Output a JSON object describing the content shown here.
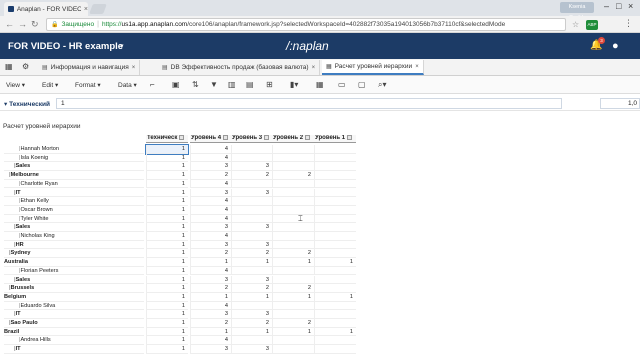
{
  "browser": {
    "tab_title": "Anaplan - FOR VIDEO - H",
    "user_chip": "Ksenia Gorikh",
    "secure_label": "Защищено",
    "url_scheme": "https://",
    "url_host": "us1a.app.anaplan.com",
    "url_path": "/core106/anaplan/framework.jsp?selectedWorkspaceId=402882f73035a194013056b7b37110cf&selectedMode",
    "ext_label": "ABP",
    "icons": [
      "back-icon",
      "forward-icon",
      "reload-icon",
      "lock-icon",
      "star-icon",
      "menu-icon"
    ]
  },
  "app": {
    "model_name": "FOR VIDEO - HR example",
    "logo": "/:naplan",
    "notifications": "3",
    "accent_color": "#1c3b66"
  },
  "module_tabs": [
    {
      "label": "Информация и навигация",
      "active": false
    },
    {
      "label": "DB Эффективность продаж (базовая валюта)",
      "active": false
    },
    {
      "label": "Расчет уровней иерархии",
      "active": true
    }
  ],
  "toolbar": {
    "view": "View",
    "edit": "Edit",
    "format": "Format",
    "data": "Data"
  },
  "context": {
    "dimension": "Технический",
    "value": "1",
    "right_value": "1,0"
  },
  "grid": {
    "title": "Расчет уровней иерархии",
    "columns": [
      "Техническ",
      "Уровень 4",
      "Уровень 3",
      "Уровень 2",
      "Уровень 1"
    ],
    "rows": [
      {
        "label": "Hannah Morton",
        "indent": 3,
        "bold": false,
        "v": [
          "1",
          "4",
          "",
          "",
          ""
        ]
      },
      {
        "label": "Isla Koenig",
        "indent": 3,
        "bold": false,
        "v": [
          "1",
          "4",
          "",
          "",
          ""
        ]
      },
      {
        "label": "Sales",
        "indent": 2,
        "bold": true,
        "v": [
          "1",
          "3",
          "3",
          "",
          ""
        ]
      },
      {
        "label": "Melbourne",
        "indent": 1,
        "bold": true,
        "v": [
          "1",
          "2",
          "2",
          "2",
          ""
        ]
      },
      {
        "label": "Charlotte Ryan",
        "indent": 3,
        "bold": false,
        "v": [
          "1",
          "4",
          "",
          "",
          ""
        ]
      },
      {
        "label": "IT",
        "indent": 2,
        "bold": true,
        "v": [
          "1",
          "3",
          "3",
          "",
          ""
        ]
      },
      {
        "label": "Ethan Kelly",
        "indent": 3,
        "bold": false,
        "v": [
          "1",
          "4",
          "",
          "",
          ""
        ]
      },
      {
        "label": "Oscar Brown",
        "indent": 3,
        "bold": false,
        "v": [
          "1",
          "4",
          "",
          "",
          ""
        ]
      },
      {
        "label": "Tyler White",
        "indent": 3,
        "bold": false,
        "v": [
          "1",
          "4",
          "",
          "",
          ""
        ]
      },
      {
        "label": "Sales",
        "indent": 2,
        "bold": true,
        "v": [
          "1",
          "3",
          "3",
          "",
          ""
        ]
      },
      {
        "label": "Nicholas King",
        "indent": 3,
        "bold": false,
        "v": [
          "1",
          "4",
          "",
          "",
          ""
        ]
      },
      {
        "label": "HR",
        "indent": 2,
        "bold": true,
        "v": [
          "1",
          "3",
          "3",
          "",
          ""
        ]
      },
      {
        "label": "Sydney",
        "indent": 1,
        "bold": true,
        "v": [
          "1",
          "2",
          "2",
          "2",
          ""
        ]
      },
      {
        "label": "Australia",
        "indent": 0,
        "bold": true,
        "v": [
          "1",
          "1",
          "1",
          "1",
          "1"
        ]
      },
      {
        "label": "Florian Peeters",
        "indent": 3,
        "bold": false,
        "v": [
          "1",
          "4",
          "",
          "",
          ""
        ]
      },
      {
        "label": "Sales",
        "indent": 2,
        "bold": true,
        "v": [
          "1",
          "3",
          "3",
          "",
          ""
        ]
      },
      {
        "label": "Brussels",
        "indent": 1,
        "bold": true,
        "v": [
          "1",
          "2",
          "2",
          "2",
          ""
        ]
      },
      {
        "label": "Belgium",
        "indent": 0,
        "bold": true,
        "v": [
          "1",
          "1",
          "1",
          "1",
          "1"
        ]
      },
      {
        "label": "Eduardo Silva",
        "indent": 3,
        "bold": false,
        "v": [
          "1",
          "4",
          "",
          "",
          ""
        ]
      },
      {
        "label": "IT",
        "indent": 2,
        "bold": true,
        "v": [
          "1",
          "3",
          "3",
          "",
          ""
        ]
      },
      {
        "label": "Sao Paulo",
        "indent": 1,
        "bold": true,
        "v": [
          "1",
          "2",
          "2",
          "2",
          ""
        ]
      },
      {
        "label": "Brazil",
        "indent": 0,
        "bold": true,
        "v": [
          "1",
          "1",
          "1",
          "1",
          "1"
        ]
      },
      {
        "label": "Andrea Hills",
        "indent": 3,
        "bold": false,
        "v": [
          "1",
          "4",
          "",
          "",
          ""
        ]
      },
      {
        "label": "IT",
        "indent": 2,
        "bold": true,
        "v": [
          "1",
          "3",
          "3",
          "",
          ""
        ]
      }
    ]
  }
}
